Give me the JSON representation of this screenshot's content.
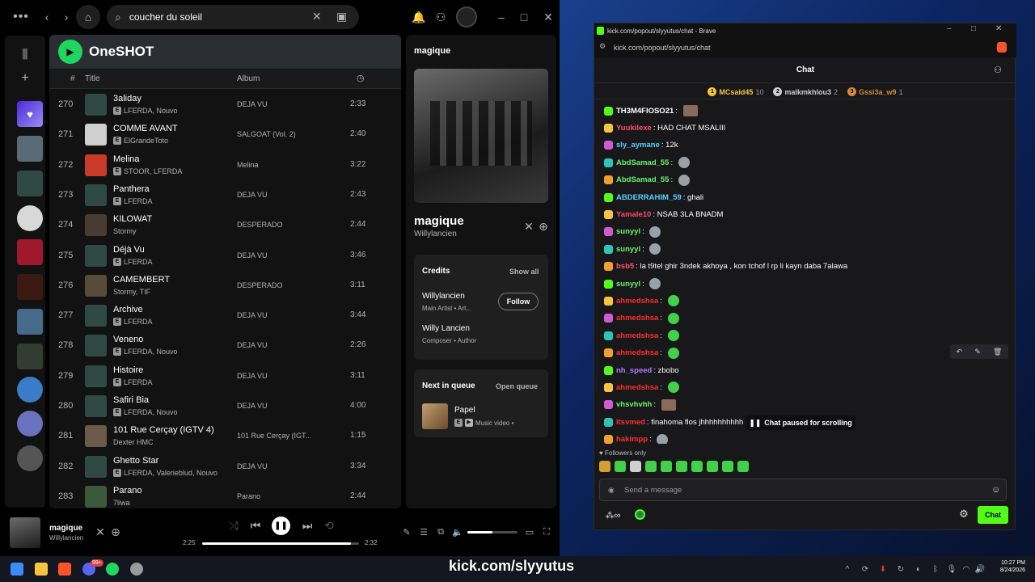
{
  "spotify": {
    "search_value": "coucher du soleil",
    "playlist_title": "OneSHOT",
    "columns": {
      "num": "#",
      "title": "Title",
      "album": "Album"
    },
    "tracks": [
      {
        "num": "270",
        "title": "3aliday",
        "artists": "LFERDA, Nouvo",
        "explicit": true,
        "album": "DEJA VU",
        "duration": "2:33"
      },
      {
        "num": "271",
        "title": "COMME AVANT",
        "artists": "ElGrandeToto",
        "explicit": true,
        "album": "SALGOAT (Vol. 2)",
        "duration": "2:40"
      },
      {
        "num": "272",
        "title": "Melina",
        "artists": "STOOR, LFERDA",
        "explicit": true,
        "album": "Melina",
        "duration": "3:22"
      },
      {
        "num": "273",
        "title": "Panthera",
        "artists": "LFERDA",
        "explicit": true,
        "album": "DEJA VU",
        "duration": "2:43"
      },
      {
        "num": "274",
        "title": "KILOWAT",
        "artists": "Stormy",
        "explicit": false,
        "album": "DESPERADO",
        "duration": "2:44"
      },
      {
        "num": "275",
        "title": "Déjà Vu",
        "artists": "LFERDA",
        "explicit": true,
        "album": "DEJA VU",
        "duration": "3:46"
      },
      {
        "num": "276",
        "title": "CAMEMBERT",
        "artists": "Stormy, TIF",
        "explicit": false,
        "album": "DESPERADO",
        "duration": "3:11"
      },
      {
        "num": "277",
        "title": "Archive",
        "artists": "LFERDA",
        "explicit": true,
        "album": "DEJA VU",
        "duration": "3:44"
      },
      {
        "num": "278",
        "title": "Veneno",
        "artists": "LFERDA, Nouvo",
        "explicit": true,
        "album": "DEJA VU",
        "duration": "2:26"
      },
      {
        "num": "279",
        "title": "Histoire",
        "artists": "LFERDA",
        "explicit": true,
        "album": "DEJA VU",
        "duration": "3:11"
      },
      {
        "num": "280",
        "title": "Safiri Bia",
        "artists": "LFERDA, Nouvo",
        "explicit": true,
        "album": "DEJA VU",
        "duration": "4:00"
      },
      {
        "num": "281",
        "title": "101 Rue Cerçay (IGTV 4)",
        "artists": "Dexter HMC",
        "explicit": false,
        "album": "101 Rue Cerçay (IGT...",
        "duration": "1:15"
      },
      {
        "num": "282",
        "title": "Ghetto Star",
        "artists": "LFERDA, Valerieblud, Nouvo",
        "explicit": true,
        "album": "DEJA VU",
        "duration": "3:34"
      },
      {
        "num": "283",
        "title": "Parano",
        "artists": "7liwa",
        "explicit": false,
        "album": "Parano",
        "duration": "2:44"
      }
    ],
    "now_playing": {
      "panel_title": "magique",
      "song": "magique",
      "artist": "Willylancien",
      "credits_label": "Credits",
      "show_all": "Show all",
      "credits": [
        {
          "name": "Willylancien",
          "role": "Main Artist • Art..."
        },
        {
          "name": "Willy Lancien",
          "role": "Composer • Author"
        }
      ],
      "follow_label": "Follow",
      "next_label": "Next in queue",
      "open_queue": "Open queue",
      "next_song": "Papel",
      "next_sub": "Music video •"
    },
    "player": {
      "song": "magique",
      "artist": "Willylancien",
      "elapsed": "2:25",
      "total": "2:32",
      "progress": 0.95,
      "volume": 0.5
    }
  },
  "chat": {
    "window_title": "kick.com/popout/slyyutus/chat - Brave",
    "url": "kick.com/popout/slyyutus/chat",
    "header": "Chat",
    "top_gifters": [
      {
        "rank": "1",
        "name": "MCsaid45",
        "count": "10",
        "color": "#f5c542"
      },
      {
        "rank": "2",
        "name": "malkmkhlou3",
        "count": "2",
        "color": "#cfcfcf"
      },
      {
        "rank": "3",
        "name": "Gssi3a_w9",
        "count": "1",
        "color": "#d38a3a"
      }
    ],
    "messages": [
      {
        "user": "TH3M4FIOSO21",
        "color": "#ffffff",
        "text": "",
        "emote": "pic"
      },
      {
        "user": "Yuukilexe",
        "color": "#ff4d6a",
        "text": "HAD CHAT MSALIII",
        "emote": ""
      },
      {
        "user": "sly_aymane",
        "color": "#5ad1ff",
        "text": "12k",
        "emote": ""
      },
      {
        "user": "AbdSamad_55",
        "color": "#6cf26c",
        "text": "",
        "emote": "rat"
      },
      {
        "user": "AbdSamad_55",
        "color": "#6cf26c",
        "text": "",
        "emote": "rat"
      },
      {
        "user": "ABDERRAHIM_59",
        "color": "#5ad1ff",
        "text": "ghali",
        "emote": ""
      },
      {
        "user": "Yamale10",
        "color": "#ff4d6a",
        "text": "NSAB 3LA BNADM",
        "emote": ""
      },
      {
        "user": "sunyyl",
        "color": "#6cf26c",
        "text": "",
        "emote": "rat"
      },
      {
        "user": "sunyyl",
        "color": "#6cf26c",
        "text": "",
        "emote": "rat"
      },
      {
        "user": "bsb5",
        "color": "#ff4d6a",
        "text": "la t9tel ghir 3ndek akhoya , kon tchof l rp li kayn daba 7alawa",
        "emote": ""
      },
      {
        "user": "sunyyl",
        "color": "#6cf26c",
        "text": "",
        "emote": "rat"
      },
      {
        "user": "ahmedshsa",
        "color": "#ff2e2e",
        "text": "",
        "emote": "green"
      },
      {
        "user": "ahmedshsa",
        "color": "#ff2e2e",
        "text": "",
        "emote": "green"
      },
      {
        "user": "ahmedshsa",
        "color": "#ff2e2e",
        "text": "",
        "emote": "green"
      },
      {
        "user": "ahmedshsa",
        "color": "#ff2e2e",
        "text": "",
        "emote": "green"
      },
      {
        "user": "nh_speed",
        "color": "#b27bff",
        "text": "zbobo",
        "emote": ""
      },
      {
        "user": "ahmedshsa",
        "color": "#ff2e2e",
        "text": "",
        "emote": "green"
      },
      {
        "user": "vhsvhvhh",
        "color": "#6cf26c",
        "text": "",
        "emote": "pic"
      },
      {
        "user": "itsvmed",
        "color": "#ff2e2e",
        "text": "finahoma flos jhhhhhhhhhh",
        "emote": ""
      },
      {
        "user": "hakimpp",
        "color": "#ff2e2e",
        "text": "",
        "emote": "rat"
      }
    ],
    "paused_label": "Chat paused for scrolling",
    "followers_only": "Followers only",
    "input_placeholder": "Send a message",
    "chat_button": "Chat"
  },
  "overlay_text": "kick.com/slyyutus",
  "taskbar": {
    "time": "10:27 PM",
    "date": "8/24/2026",
    "discord_badge": "99+"
  }
}
